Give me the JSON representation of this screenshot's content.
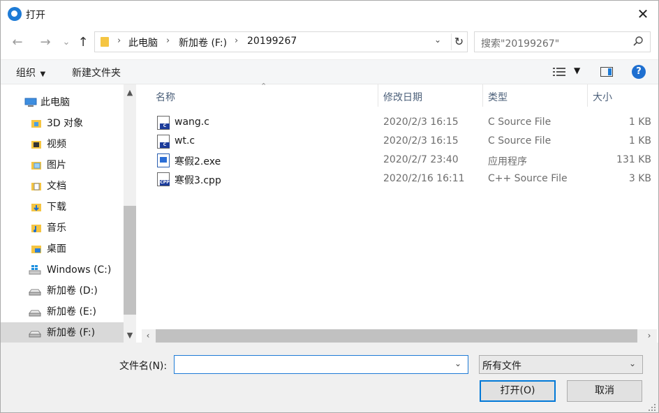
{
  "window": {
    "title": "打开",
    "close_glyph": "✕"
  },
  "nav": {
    "back": "←",
    "forward": "→",
    "recent": "⌄",
    "up": "↑"
  },
  "address": {
    "crumbs": [
      "此电脑",
      "新加卷 (F:)",
      "20199267"
    ],
    "separator": "›"
  },
  "search": {
    "placeholder": "搜索\"20199267\""
  },
  "toolbar": {
    "organize": "组织",
    "new_folder": "新建文件夹"
  },
  "sidebar": {
    "items": [
      {
        "label": "此电脑",
        "icon": "computer-icon"
      },
      {
        "label": "3D 对象",
        "icon": "folder-3d-icon"
      },
      {
        "label": "视频",
        "icon": "folder-video-icon"
      },
      {
        "label": "图片",
        "icon": "folder-pictures-icon"
      },
      {
        "label": "文档",
        "icon": "folder-documents-icon"
      },
      {
        "label": "下载",
        "icon": "folder-downloads-icon"
      },
      {
        "label": "音乐",
        "icon": "folder-music-icon"
      },
      {
        "label": "桌面",
        "icon": "folder-desktop-icon"
      },
      {
        "label": "Windows (C:)",
        "icon": "windows-drive-icon"
      },
      {
        "label": "新加卷 (D:)",
        "icon": "drive-icon"
      },
      {
        "label": "新加卷 (E:)",
        "icon": "drive-icon"
      },
      {
        "label": "新加卷 (F:)",
        "icon": "drive-icon",
        "selected": true
      }
    ]
  },
  "columns": {
    "name": "名称",
    "date": "修改日期",
    "type": "类型",
    "size": "大小"
  },
  "files": [
    {
      "name": "wang.c",
      "date": "2020/2/3 16:15",
      "type": "C Source File",
      "size": "1 KB",
      "icon": "c-file-icon"
    },
    {
      "name": "wt.c",
      "date": "2020/2/3 16:15",
      "type": "C Source File",
      "size": "1 KB",
      "icon": "c-file-icon"
    },
    {
      "name": "寒假2.exe",
      "date": "2020/2/7 23:40",
      "type": "应用程序",
      "size": "131 KB",
      "icon": "exe-file-icon"
    },
    {
      "name": "寒假3.cpp",
      "date": "2020/2/16 16:11",
      "type": "C++ Source File",
      "size": "3 KB",
      "icon": "cpp-file-icon"
    }
  ],
  "footer": {
    "filename_label": "文件名(N):",
    "filename_value": "",
    "filetype_selected": "所有文件",
    "open_button": "打开(O)",
    "cancel_button": "取消"
  },
  "colors": {
    "accent": "#0078d7",
    "selection": "#d9d9d9",
    "header_text": "#4c607a"
  }
}
